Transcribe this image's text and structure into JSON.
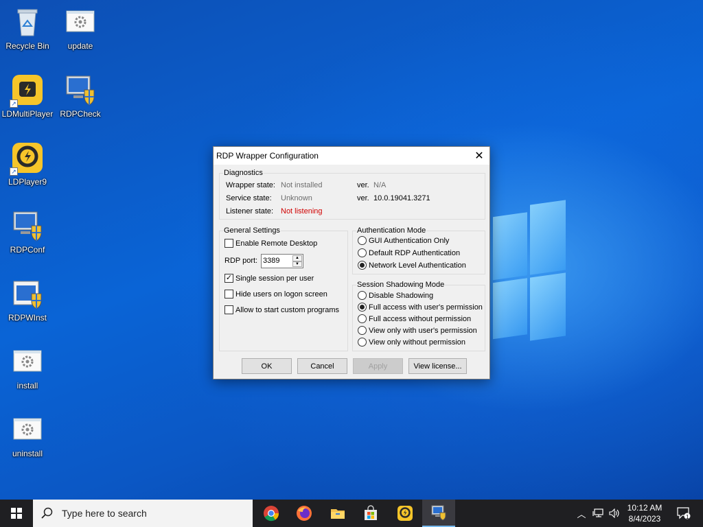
{
  "desktop": {
    "icons": [
      {
        "label": "Recycle Bin",
        "icon": "recycle-bin-icon"
      },
      {
        "label": "update",
        "icon": "script-gear-icon"
      },
      {
        "label": "LDMultiPlayer",
        "icon": "ldmultiplayer-icon"
      },
      {
        "label": "RDPCheck",
        "icon": "monitor-shield-icon"
      },
      {
        "label": "LDPlayer9",
        "icon": "ldplayer-icon"
      },
      {
        "label": "RDPConf",
        "icon": "monitor-shield-icon"
      },
      {
        "label": "RDPWInst",
        "icon": "installer-shield-icon"
      },
      {
        "label": "install",
        "icon": "script-gear-icon"
      },
      {
        "label": "uninstall",
        "icon": "script-gear-icon"
      }
    ]
  },
  "dialog": {
    "title": "RDP Wrapper Configuration",
    "diagnostics": {
      "legend": "Diagnostics",
      "wrapper_label": "Wrapper state:",
      "wrapper_value": "Not installed",
      "wrapper_ver_label": "ver.",
      "wrapper_ver": "N/A",
      "service_label": "Service state:",
      "service_value": "Unknown",
      "service_ver_label": "ver.",
      "service_ver": "10.0.19041.3271",
      "listener_label": "Listener state:",
      "listener_value": "Not listening"
    },
    "general": {
      "legend": "General Settings",
      "enable_rd": {
        "label": "Enable Remote Desktop",
        "checked": false
      },
      "port_label": "RDP port:",
      "port_value": "3389",
      "single_session": {
        "label": "Single session per user",
        "checked": true
      },
      "hide_users": {
        "label": "Hide users on logon screen",
        "checked": false
      },
      "custom_programs": {
        "label": "Allow to start custom programs",
        "checked": false
      }
    },
    "auth": {
      "legend": "Authentication Mode",
      "options": [
        "GUI Authentication Only",
        "Default RDP Authentication",
        "Network Level Authentication"
      ],
      "selected": 2
    },
    "shadow": {
      "legend": "Session Shadowing Mode",
      "options": [
        "Disable Shadowing",
        "Full access with user's permission",
        "Full access without permission",
        "View only with user's permission",
        "View only without permission"
      ],
      "selected": 1
    },
    "buttons": {
      "ok": "OK",
      "cancel": "Cancel",
      "apply": "Apply",
      "license": "View license..."
    }
  },
  "taskbar": {
    "search_placeholder": "Type here to search",
    "apps": [
      "chrome-icon",
      "firefox-icon",
      "file-explorer-icon",
      "store-icon",
      "ldplayer-icon",
      "rdpconf-icon"
    ],
    "time": "10:12 AM",
    "date": "8/4/2023",
    "notification_count": "1"
  },
  "colors": {
    "accent": "#0a64d6",
    "error": "#d00000"
  }
}
